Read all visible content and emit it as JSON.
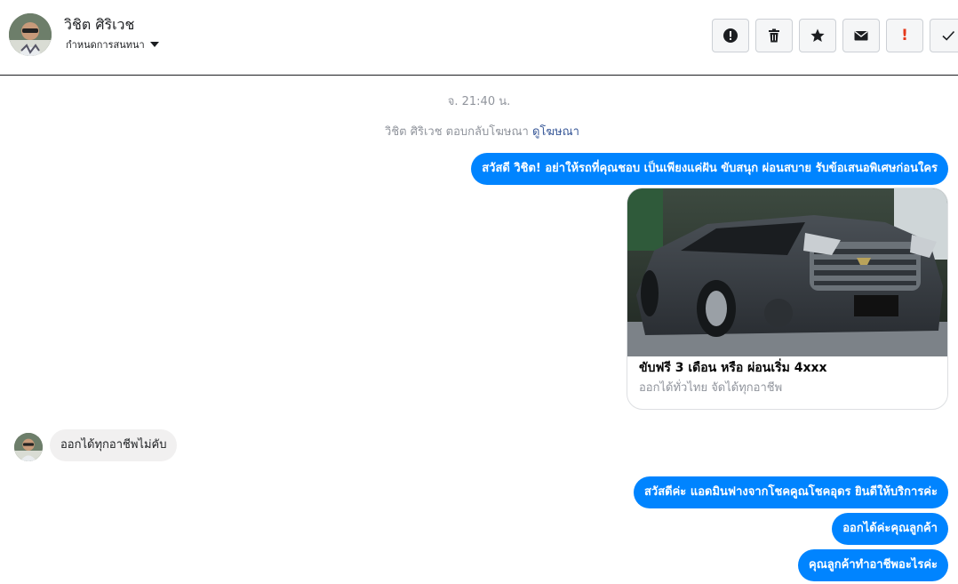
{
  "header": {
    "contact_name": "วิชิต ศิริเวช",
    "settings_label": "กำหนดการสนทนา"
  },
  "toolbar": {
    "buttons": [
      "alert-circle-icon",
      "trash-icon",
      "star-icon",
      "envelope-icon",
      "exclamation-icon",
      "check-icon"
    ],
    "exclamation_glyph": "!"
  },
  "conversation": {
    "timestamp": "จ. 21:40 น.",
    "reply_note": {
      "text": "วิชิต ศิริเวช ตอบกลับโฆษณา",
      "link": "ดูโฆษณา"
    },
    "messages": [
      {
        "from": "page",
        "text": "สวัสดี วิชิต! อย่าให้รถที่คุณชอบ เป็นเพียงแค่ฝัน ขับสนุก ผ่อนสบาย รับข้อเสนอพิเศษก่อนใคร"
      },
      {
        "from": "user",
        "text": "ออกได้ทุกอาชีพไม่คับ"
      },
      {
        "from": "page",
        "text": "สวัสดีค่ะ แอดมินฟางจากโชคคูณโชคอุดร ยินดีให้บริการค่ะ"
      },
      {
        "from": "page",
        "text": "ออกได้ค่ะคุณลูกค้า"
      },
      {
        "from": "page",
        "text": "คุณลูกค้าทำอาชีพอะไรค่ะ"
      }
    ],
    "ad_card": {
      "title": "ขับฟรี 3 เดือน หรือ ผ่อนเริ่ม 4xxx",
      "subtitle": "ออกได้ทั่วไทย จัดได้ทุกอาชีพ"
    }
  },
  "colors": {
    "outgoing_bubble": "#0084ff",
    "incoming_bubble": "#f1f0f0",
    "link": "#385898",
    "meta_text": "#90949c"
  }
}
